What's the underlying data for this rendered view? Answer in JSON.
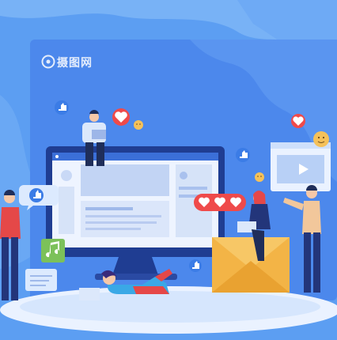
{
  "watermark": {
    "text": "摄图网"
  },
  "colors": {
    "background": "#5b9df0",
    "panel": "#4a86ea",
    "monitor_frame": "#1f3b8f",
    "screen": "#eef4ff",
    "heart_red": "#ef4a4a",
    "like_blue": "#3b7ce6",
    "envelope": "#f5b649",
    "music_green": "#7cc15a",
    "skin": "#f6c8a8"
  },
  "icons": [
    "like-icon",
    "heart-icon",
    "smile-emoji-icon",
    "play-icon",
    "music-note-icon",
    "chat-bubble-icon",
    "envelope-icon",
    "laptop-icon"
  ]
}
